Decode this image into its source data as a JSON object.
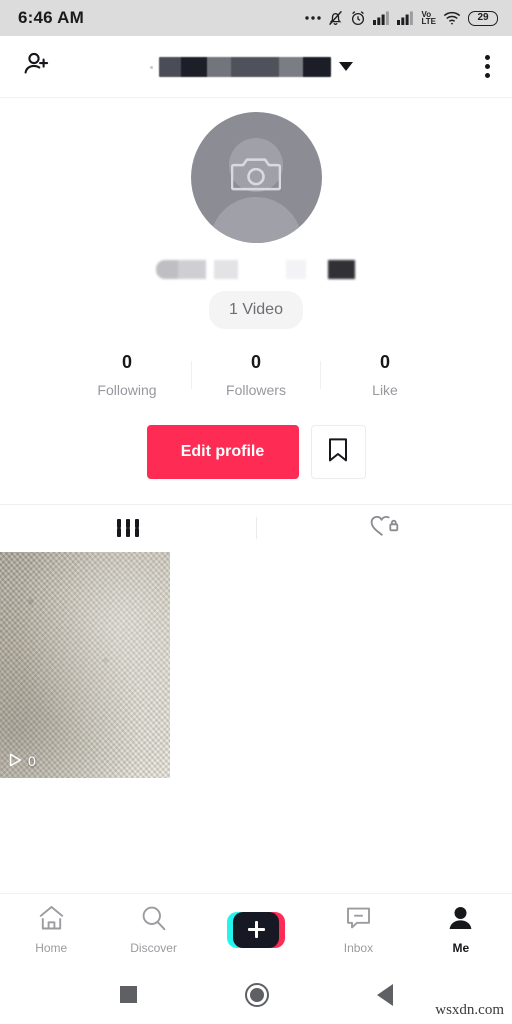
{
  "status_bar": {
    "time": "6:46 AM",
    "battery_level": "29",
    "icons": [
      "more-dots-icon",
      "notifications-muted-icon",
      "alarm-icon",
      "signal-1-icon",
      "signal-2-icon",
      "volte-icon",
      "wifi-icon",
      "battery-icon"
    ],
    "volte_top": "Vo",
    "volte_bottom": "LTE"
  },
  "app_bar": {
    "add_friends_icon": "add-person-icon",
    "username": "",
    "username_redacted": true,
    "dropdown_icon": "chevron-down-icon",
    "menu_icon": "kebab-menu-icon"
  },
  "profile": {
    "avatar_icon": "camera-icon",
    "avatar_placeholder": true,
    "handle": "",
    "handle_redacted": true,
    "video_badge": "1 Video",
    "stats": [
      {
        "value": "0",
        "label": "Following"
      },
      {
        "value": "0",
        "label": "Followers"
      },
      {
        "value": "0",
        "label": "Like"
      }
    ],
    "edit_profile_label": "Edit profile",
    "bookmark_icon": "bookmark-icon"
  },
  "tabs": [
    {
      "icon": "grid-icon",
      "active": true
    },
    {
      "icon": "heart-lock-icon",
      "active": false
    }
  ],
  "videos": [
    {
      "play_count": "0",
      "play_icon": "play-icon"
    }
  ],
  "bottom_nav": [
    {
      "label": "Home",
      "icon": "home-icon",
      "active": false
    },
    {
      "label": "Discover",
      "icon": "search-icon",
      "active": false
    },
    {
      "label": "",
      "icon": "create-plus-icon",
      "active": false
    },
    {
      "label": "Inbox",
      "icon": "inbox-icon",
      "active": false
    },
    {
      "label": "Me",
      "icon": "person-icon",
      "active": true
    }
  ],
  "android_nav": {
    "recents_icon": "square-recents-icon",
    "home_icon": "circle-home-icon",
    "back_icon": "triangle-back-icon"
  },
  "watermark": "wsxdn.com",
  "colors": {
    "accent": "#fe2c55",
    "cyan": "#25f4ee",
    "dark": "#161823",
    "muted": "#97979d"
  }
}
